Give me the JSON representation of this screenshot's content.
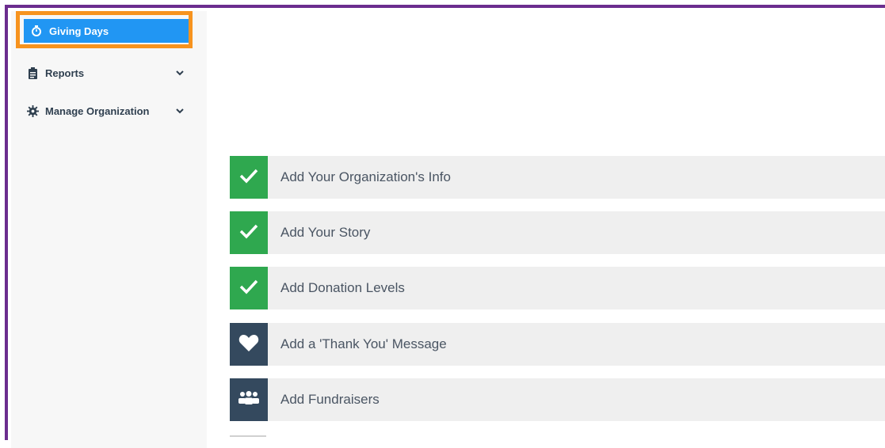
{
  "sidebar": {
    "items": [
      {
        "label": "Giving Days",
        "icon": "stopwatch-icon",
        "active": true
      },
      {
        "label": "Reports",
        "icon": "clipboard-icon",
        "expandable": true
      },
      {
        "label": "Manage Organization",
        "icon": "gear-icon",
        "expandable": true
      }
    ]
  },
  "tasks": [
    {
      "label": "Add Your Organization's Info",
      "status": "complete",
      "icon": "checkmark-icon"
    },
    {
      "label": "Add Your Story",
      "status": "complete",
      "icon": "checkmark-icon"
    },
    {
      "label": "Add Donation Levels",
      "status": "complete",
      "icon": "checkmark-icon"
    },
    {
      "label": "Add a 'Thank You' Message",
      "status": "incomplete",
      "icon": "heart-icon"
    },
    {
      "label": "Add Fundraisers",
      "status": "incomplete",
      "icon": "users-icon"
    }
  ],
  "colors": {
    "frame": "#6b2d8e",
    "active_nav": "#2196f3",
    "highlight": "#f7931e",
    "complete": "#2fa84f",
    "incomplete": "#34495e"
  }
}
